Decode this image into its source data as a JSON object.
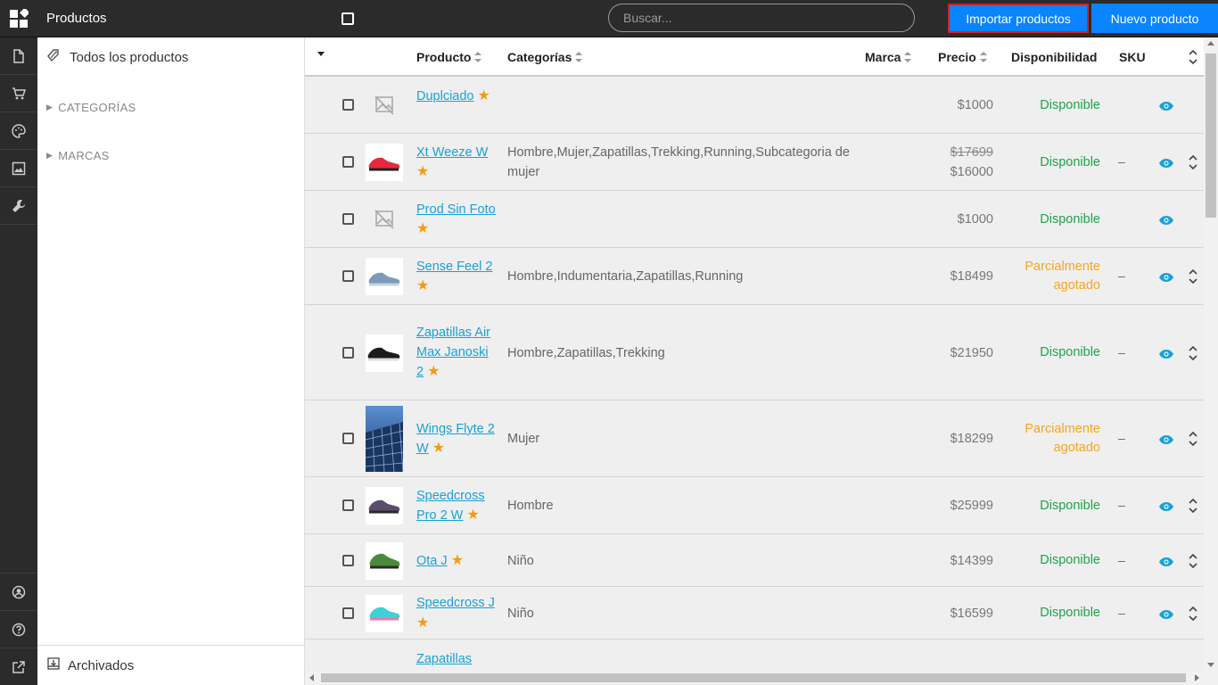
{
  "header": {
    "title": "Productos",
    "search_placeholder": "Buscar...",
    "import_label": "Importar productos",
    "new_label": "Nuevo producto"
  },
  "rail": {
    "icons": [
      "document-icon",
      "cart-icon",
      "palette-icon",
      "image-icon",
      "wrench-icon",
      "user-circle-icon",
      "help-icon",
      "external-link-icon"
    ]
  },
  "sidebar": {
    "all_products": "Todos los productos",
    "categories": "CATEGORÍAS",
    "brands": "MARCAS",
    "archived": "Archivados"
  },
  "table": {
    "headers": {
      "product": "Producto",
      "categories": "Categorías",
      "brand": "Marca",
      "price": "Precio",
      "availability": "Disponibilidad",
      "sku": "SKU"
    },
    "rows": [
      {
        "name": "Duplciado",
        "categories": "",
        "price": "$1000",
        "old_price": "",
        "availability": "Disponible",
        "sku": "",
        "thumb": "no-image"
      },
      {
        "name": "Xt Weeze W",
        "categories": "Hombre,Mujer,Zapatillas,Trekking,Running,Subcategoria de mujer",
        "price": "$16000",
        "old_price": "$17699",
        "availability": "Disponible",
        "sku": "–",
        "thumb": "red-shoe"
      },
      {
        "name": "Prod Sin Foto",
        "categories": "",
        "price": "$1000",
        "old_price": "",
        "availability": "Disponible",
        "sku": "",
        "thumb": "no-image"
      },
      {
        "name": "Sense Feel 2",
        "categories": "Hombre,Indumentaria,Zapatillas,Running",
        "price": "$18499",
        "old_price": "",
        "availability": "Parcialmente agotado",
        "sku": "–",
        "thumb": "blue-shoe"
      },
      {
        "name": "Zapatillas Air Max Janoski 2",
        "categories": "Hombre,Zapatillas,Trekking",
        "price": "$21950",
        "old_price": "",
        "availability": "Disponible",
        "sku": "–",
        "thumb": "black-shoe"
      },
      {
        "name": "Wings Flyte 2 W",
        "categories": "Mujer",
        "price": "$18299",
        "old_price": "",
        "availability": "Parcialmente agotado",
        "sku": "–",
        "thumb": "solar-panel"
      },
      {
        "name": "Speedcross Pro 2 W",
        "categories": "Hombre",
        "price": "$25999",
        "old_price": "",
        "availability": "Disponible",
        "sku": "–",
        "thumb": "purple-shoe"
      },
      {
        "name": "Ota J",
        "categories": "Niño",
        "price": "$14399",
        "old_price": "",
        "availability": "Disponible",
        "sku": "–",
        "thumb": "green-shoe"
      },
      {
        "name": "Speedcross J",
        "categories": "Niño",
        "price": "$16599",
        "old_price": "",
        "availability": "Disponible",
        "sku": "–",
        "thumb": "cyan-shoe"
      },
      {
        "name": "Zapatillas",
        "categories": "",
        "price": "",
        "old_price": "",
        "availability": "",
        "sku": "",
        "thumb": ""
      }
    ]
  },
  "colors": {
    "accent": "#0a84ff",
    "link": "#1aa1d6",
    "available": "#1ea34a",
    "partial": "#f5a623",
    "star": "#f39c12",
    "topbar": "#2b2b2b"
  }
}
